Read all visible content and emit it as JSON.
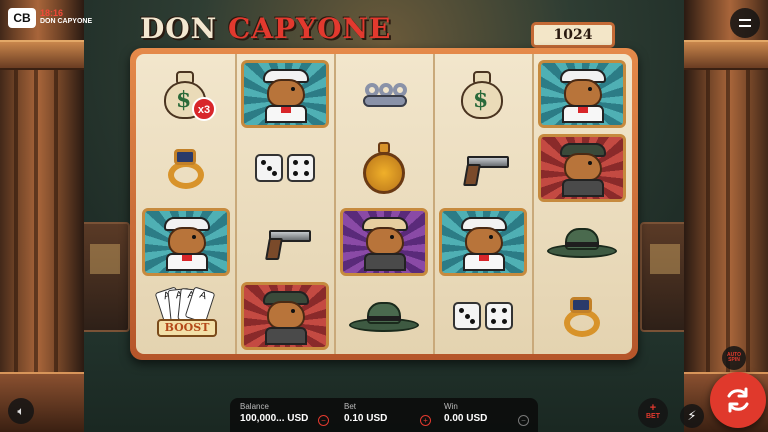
{
  "top_bar": {
    "logo_glyph": "CB",
    "time": "18:16",
    "brand": "DON CAPYONE"
  },
  "title": {
    "part1": "DON",
    "part2": "CAPYONE"
  },
  "ways_badge": "1024 WAYS",
  "reels": [
    [
      "money-bag-x3",
      "ring",
      "capybara-teal",
      "cards-boost"
    ],
    [
      "capybara-teal",
      "dice",
      "gun",
      "capybara-red"
    ],
    [
      "brass-knuckles",
      "pocket-watch",
      "capybara-purple",
      "fedora"
    ],
    [
      "money-bag",
      "gun",
      "capybara-teal",
      "dice"
    ],
    [
      "capybara-teal",
      "capybara-red",
      "fedora",
      "ring"
    ]
  ],
  "multiplier_label": "x3",
  "boost_label": "BOOST",
  "balance": {
    "label": "Balance",
    "value": "100,000... USD"
  },
  "bet": {
    "label": "Bet",
    "value": "0.10 USD"
  },
  "win": {
    "label": "Win",
    "value": "0.00 USD"
  },
  "controls": {
    "bet_button": "BET",
    "autospin_line1": "AUTO",
    "autospin_line2": "SPIN"
  },
  "colors": {
    "accent_red": "#e0392c",
    "frame_orange": "#d8763c"
  }
}
